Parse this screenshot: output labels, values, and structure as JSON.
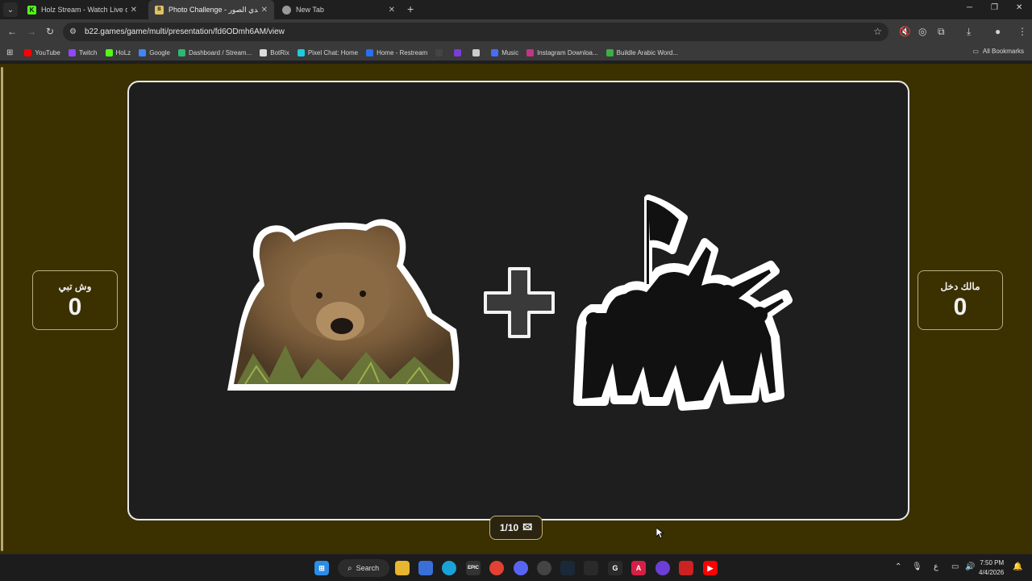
{
  "tabs": [
    {
      "title": "Holz Stream - Watch Live on Ki",
      "favicon": "kick-icon",
      "color": "#53fc18",
      "active": false
    },
    {
      "title": "Photo Challenge - تحدي الصور",
      "favicon": "b22-icon",
      "color": "#e0c060",
      "active": true
    },
    {
      "title": "New Tab",
      "favicon": "chrome-icon",
      "color": "#cccccc",
      "active": false
    }
  ],
  "toolbar": {
    "url": "b22.games/game/multi/presentation/fd6ODmh6AM/view"
  },
  "bookmarks": [
    {
      "label": "YouTube",
      "color": "#ff0000"
    },
    {
      "label": "Twitch",
      "color": "#9146ff"
    },
    {
      "label": "HoLz",
      "color": "#53fc18"
    },
    {
      "label": "Google",
      "color": "#4285f4"
    },
    {
      "label": "Dashboard / Stream...",
      "color": "#2eb872"
    },
    {
      "label": "BotRix",
      "color": "#dddddd"
    },
    {
      "label": "Pixel Chat: Home",
      "color": "#1ecbe1"
    },
    {
      "label": "Home - Restream",
      "color": "#2a6ff0"
    },
    {
      "label": "",
      "color": "#444444"
    },
    {
      "label": "",
      "color": "#7a3dd6"
    },
    {
      "label": "",
      "color": "#cccccc"
    },
    {
      "label": "Music",
      "color": "#4a6cf7"
    },
    {
      "label": "Instagram Downloa...",
      "color": "#c13584"
    },
    {
      "label": "Buildle Arabic Word...",
      "color": "#3cb043"
    }
  ],
  "all_bookmarks_label": "All Bookmarks",
  "game": {
    "left_team": {
      "name": "وش تبي",
      "score": "0"
    },
    "right_team": {
      "name": "مالك دخل",
      "score": "0"
    },
    "counter": "1/10",
    "left_image": "brown-bear-photo",
    "right_image": "soldiers-silhouette-with-flag",
    "operator": "plus"
  },
  "taskbar": {
    "search_label": "Search",
    "time": "7:50 PM",
    "date": "4/4/2026",
    "language": "ع"
  },
  "colors": {
    "page_background": "#3b3000",
    "stage_background": "#1e1e1e",
    "accent": "#c7b47a"
  }
}
